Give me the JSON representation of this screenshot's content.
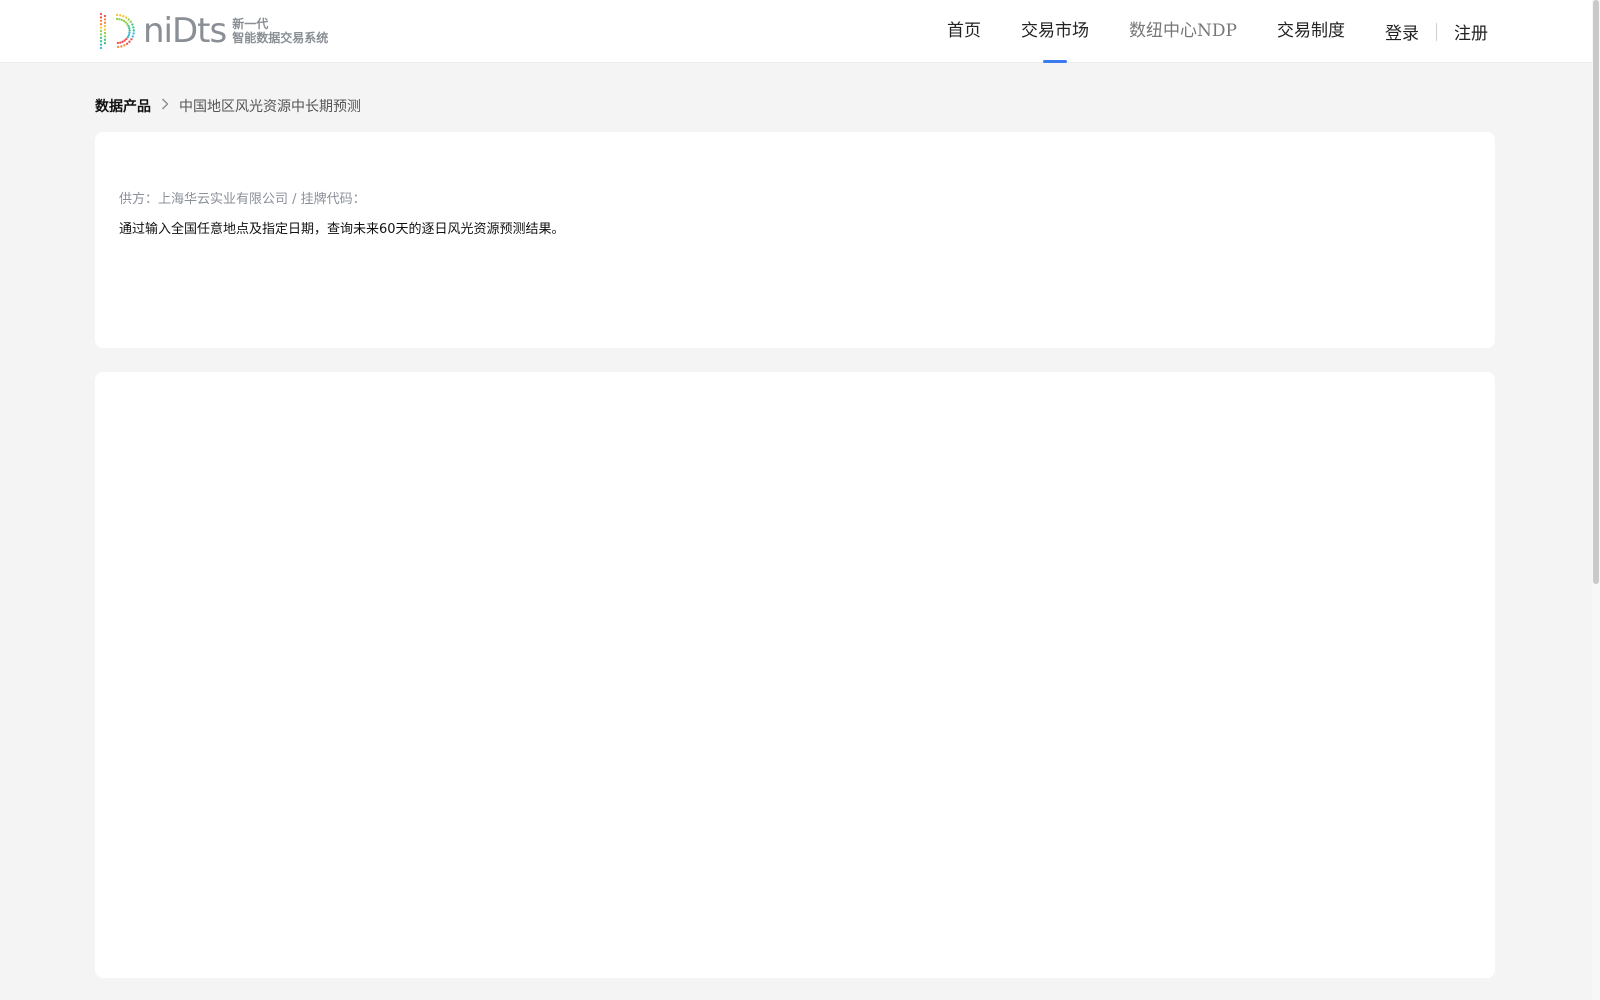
{
  "header": {
    "logo": {
      "word": "niDts",
      "tag_line1": "新一代",
      "tag_line2": "智能数据交易系统"
    },
    "nav": [
      {
        "label": "首页",
        "active": false
      },
      {
        "label": "交易市场",
        "active": true
      },
      {
        "label": "数纽中心NDP",
        "active": false
      },
      {
        "label": "交易制度",
        "active": false
      }
    ],
    "auth": {
      "login": "登录",
      "register": "注册"
    }
  },
  "breadcrumb": {
    "root": "数据产品",
    "separator_icon": "chevron-right-icon",
    "current": "中国地区风光资源中长期预测"
  },
  "product": {
    "supplier_line": "供方：上海华云实业有限公司 / 挂牌代码：",
    "description": "通过输入全国任意地点及指定日期，查询未来60天的逐日风光资源预测结果。"
  },
  "colors": {
    "accent": "#3a7bf0",
    "background": "#f4f4f4",
    "card": "#ffffff"
  }
}
